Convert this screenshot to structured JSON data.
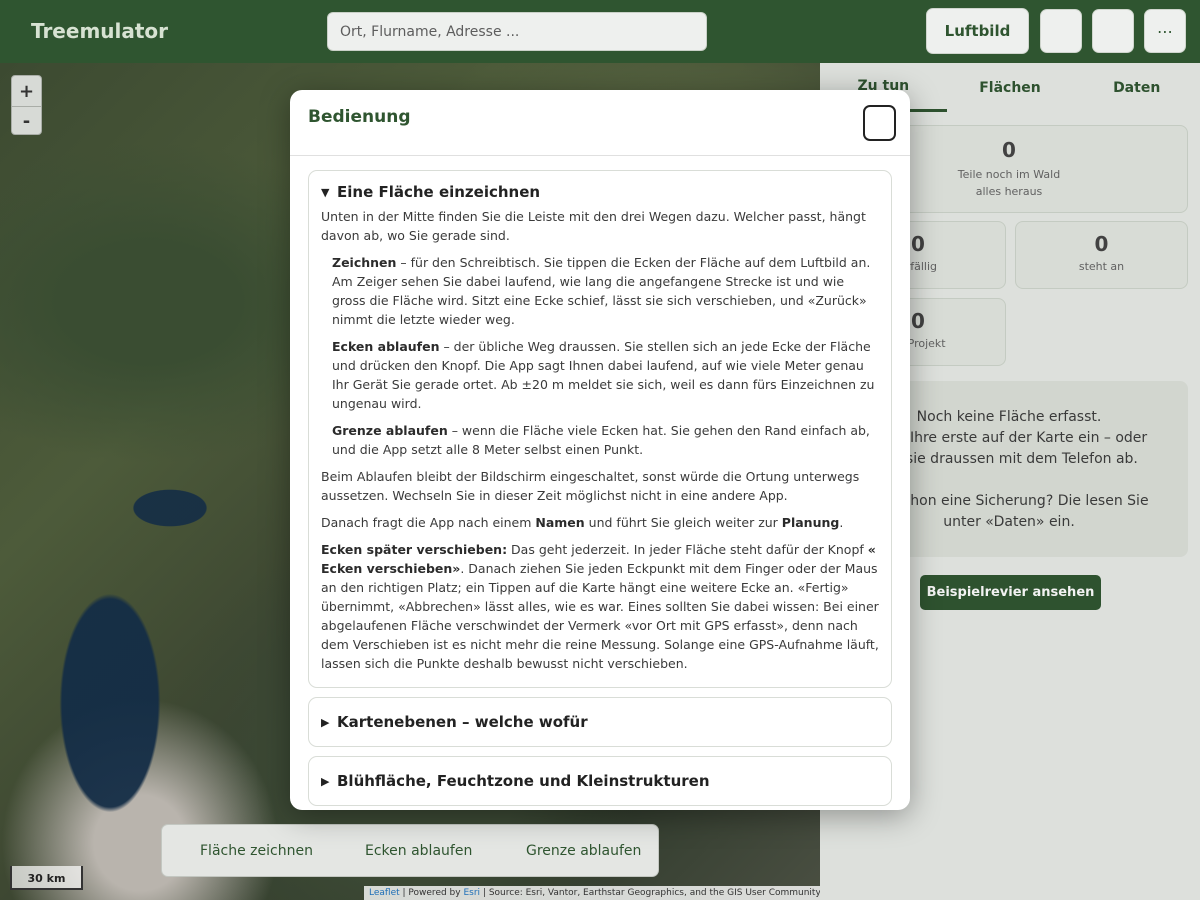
{
  "header": {
    "brand": "Treemulator",
    "search_placeholder": "Ort, Flurname, Adresse ...",
    "luftbild_label": "Luftbild",
    "more_label": "⋯"
  },
  "map": {
    "zoom_in": "+",
    "zoom_out": "-",
    "scale_label": "30 km",
    "attribution": {
      "leaflet": "Leaflet",
      "powered_by": "| Powered by",
      "esri": "Esri",
      "source": "| Source: Esri, Vantor, Earthstar Geographics, and the GIS User Community"
    },
    "toolbar": {
      "draw": "Fläche zeichnen",
      "walk_corners": "Ecken ablaufen",
      "walk_border": "Grenze ablaufen"
    }
  },
  "panel": {
    "tabs": [
      "Zu tun",
      "Flächen",
      "Daten"
    ],
    "stats": {
      "forest": {
        "num": "0",
        "label1": "Teile noch im Wald",
        "label2": "alles heraus"
      },
      "overdue": {
        "num": "0",
        "label": "erfällig"
      },
      "due": {
        "num": "0",
        "label": "steht an"
      },
      "project": {
        "num": "0",
        "label": "im Projekt"
      }
    },
    "empty": {
      "line1": "Noch keine Fläche erfasst.",
      "line2": "n Sie Ihre erste auf der Karte ein – oder",
      "line3": "Sie sie draussen mit dem Telefon ab.",
      "line4": "Sie schon eine Sicherung? Die lesen Sie",
      "line5": "unter «Daten» ein."
    },
    "example_button": "Beispielrevier ansehen"
  },
  "modal": {
    "title": "Bedienung",
    "sections": [
      {
        "title": "Eine Fläche einzeichnen",
        "intro": "Unten in der Mitte finden Sie die Leiste mit den drei Wegen dazu. Welcher passt, hängt davon ab, wo Sie gerade sind.",
        "zeichnen_term": "Zeichnen",
        "zeichnen_text": " – für den Schreibtisch. Sie tippen die Ecken der Fläche auf dem Luftbild an. Am Zeiger sehen Sie dabei laufend, wie lang die angefangene Strecke ist und wie gross die Fläche wird. Sitzt eine Ecke schief, lässt sie sich verschieben, und «Zurück» nimmt die letzte wieder weg.",
        "ecken_term": "Ecken ablaufen",
        "ecken_text": " – der übliche Weg draussen. Sie stellen sich an jede Ecke der Fläche und drücken den Knopf. Die App sagt Ihnen dabei laufend, auf wie viele Meter genau Ihr Gerät Sie gerade ortet. Ab ±20 m meldet sie sich, weil es dann fürs Einzeichnen zu ungenau wird.",
        "grenze_term": "Grenze ablaufen",
        "grenze_text": " – wenn die Fläche viele Ecken hat. Sie gehen den Rand einfach ab, und die App setzt alle 8 Meter selbst einen Punkt.",
        "screen_note": "Beim Ablaufen bleibt der Bildschirm eingeschaltet, sonst würde die Ortung unterwegs aussetzen. Wechseln Sie in dieser Zeit möglichst nicht in eine andere App.",
        "after_1": "Danach fragt die App nach einem ",
        "after_name": "Namen",
        "after_2": " und führt Sie gleich weiter zur ",
        "after_plan": "Planung",
        "after_3": ".",
        "move_term": "Ecken später verschieben:",
        "move_1": " Das geht jederzeit. In jeder Fläche steht dafür der Knopf ",
        "move_button": "«   Ecken verschieben»",
        "move_2": ". Danach ziehen Sie jeden Eckpunkt mit dem Finger oder der Maus an den richtigen Platz; ein Tippen auf die Karte hängt eine weitere Ecke an. «Fertig» übernimmt, «Abbrechen» lässt alles, wie es war. Eines sollten Sie dabei wissen: Bei einer abgelaufenen Fläche verschwindet der Vermerk «vor Ort mit GPS erfasst», denn nach dem Verschieben ist es nicht mehr die reine Messung. Solange eine GPS-Aufnahme läuft, lassen sich die Punkte deshalb bewusst nicht verschieben."
      },
      {
        "title": "Kartenebenen – welche wofür"
      },
      {
        "title": "Blühfläche, Feuchtzone und Kleinstrukturen"
      }
    ]
  }
}
